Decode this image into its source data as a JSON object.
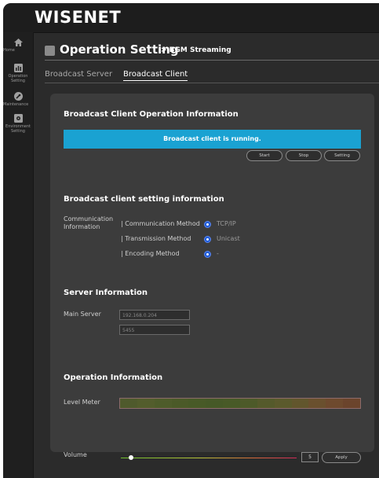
{
  "brand": {
    "logo": "WISENET"
  },
  "sidebar": {
    "items": [
      {
        "label": "Home",
        "icon": "home-icon"
      },
      {
        "label": "Operation Setting",
        "icon": "operation-setting-icon"
      },
      {
        "label": "Maintenance",
        "icon": "maintenance-icon"
      },
      {
        "label": "Environment Setting",
        "icon": "environment-setting-icon"
      }
    ]
  },
  "header": {
    "title": "Operation Setting",
    "subtitle": "> BGM Streaming"
  },
  "tabs": [
    {
      "label": "Broadcast Server",
      "active": false
    },
    {
      "label": "Broadcast Client",
      "active": true
    }
  ],
  "client_info": {
    "title": "Broadcast Client Operation Information",
    "status": "Broadcast client is running.",
    "status_color": "#1aa2d2",
    "buttons": {
      "start": "Start",
      "stop": "Stop",
      "setting": "Setting"
    }
  },
  "setting_info": {
    "title": "Broadcast client setting information",
    "group_label": "Communication Information",
    "rows": [
      {
        "label": "| Communication Method",
        "value": "TCP/IP"
      },
      {
        "label": "| Transmission Method",
        "value": "Unicast"
      },
      {
        "label": "| Encoding Method",
        "value": "-"
      }
    ]
  },
  "server_info": {
    "title": "Server Information",
    "main_server_label": "Main Server",
    "ip_value": "192.168.0.204",
    "port_value": "5455"
  },
  "operation_info": {
    "title": "Operation Information",
    "level_meter_label": "Level Meter",
    "level_meter_colors": [
      "#4f5a2c",
      "#535d2c",
      "#4e5c2a",
      "#4b5a28",
      "#485a27",
      "#465927",
      "#485a27",
      "#4d5a29",
      "#555a2b",
      "#5b5a2c",
      "#62562d",
      "#6a502e",
      "#6e4a2e",
      "#6b442c"
    ],
    "volume_label": "Volume",
    "volume_value": "5",
    "volume_level": 0.06,
    "apply_label": "Apply"
  },
  "colors": {
    "accent": "#1aa2d2",
    "radio": "#1f5bd6"
  }
}
